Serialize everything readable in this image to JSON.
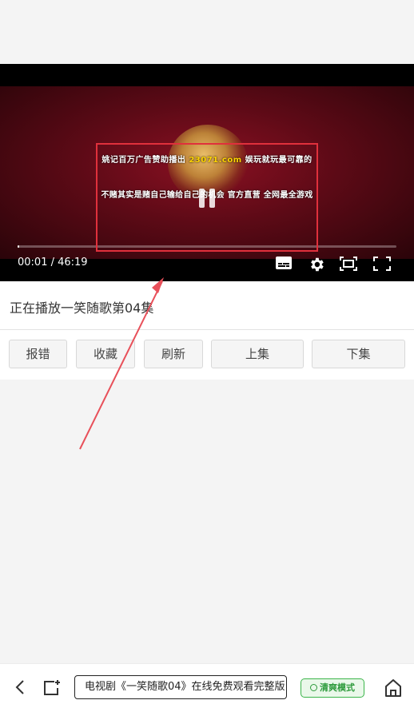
{
  "player": {
    "ad_line1_prefix": "姚记百万广告赞助播出",
    "ad_line1_url": "23071.com",
    "ad_line1_suffix": "娱玩就玩最可靠的",
    "ad_line2": "不赌其实是赌自己输给自己的机会 官方直营 全网最全游戏",
    "current_time": "00:01",
    "total_time": "46:19",
    "time_display": "00:01 / 46:19",
    "progress": 0.0004,
    "icons": [
      "subtitles-icon",
      "gear-icon",
      "picture-in-picture-icon",
      "fullscreen-icon"
    ]
  },
  "now_playing": "正在播放一笑随歌第04集",
  "actions": [
    "报错",
    "收藏",
    "刷新",
    "上集",
    "下集"
  ],
  "bottom_bar": {
    "url_text": "电视剧《一笑随歌04》在线免费观看完整版",
    "mode_label": "清爽模式",
    "icons": [
      "back-icon",
      "tab-icon",
      "home-icon"
    ]
  },
  "colors": {
    "accent_green": "#3bb54a",
    "annotation_red": "#e0303c",
    "video_bg": "#5c0a16"
  }
}
